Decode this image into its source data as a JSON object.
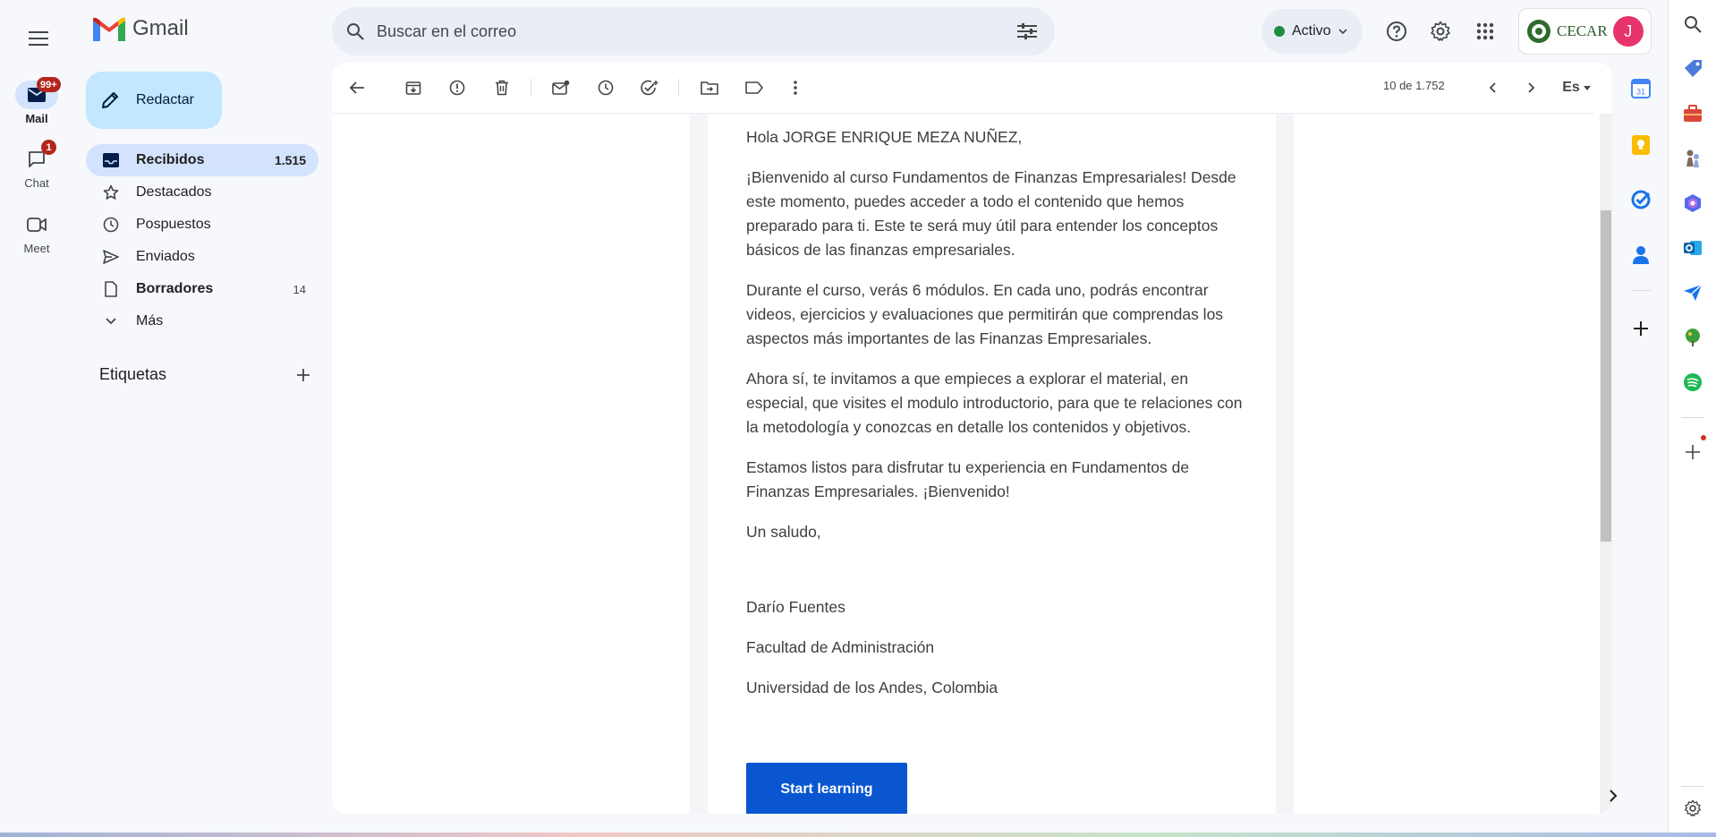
{
  "app": {
    "name": "Gmail"
  },
  "rail": {
    "items": [
      {
        "label": "Mail",
        "badge": "99+",
        "active": true
      },
      {
        "label": "Chat",
        "badge": "1"
      },
      {
        "label": "Meet",
        "badge": ""
      }
    ]
  },
  "search": {
    "placeholder": "Buscar en el correo"
  },
  "header": {
    "status": "Activo",
    "account_org": "CECAR",
    "avatar_letter": "J"
  },
  "compose": {
    "label": "Redactar"
  },
  "nav": {
    "items": [
      {
        "label": "Recibidos",
        "count": "1.515"
      },
      {
        "label": "Destacados",
        "count": ""
      },
      {
        "label": "Pospuestos",
        "count": ""
      },
      {
        "label": "Enviados",
        "count": ""
      },
      {
        "label": "Borradores",
        "count": "14"
      },
      {
        "label": "Más",
        "count": ""
      }
    ],
    "labels_heading": "Etiquetas"
  },
  "toolbar": {
    "pager": "10 de 1.752",
    "lang": "Es"
  },
  "email": {
    "greeting": "Hola JORGE ENRIQUE MEZA NUÑEZ,",
    "p1": "¡Bienvenido al curso Fundamentos de Finanzas Empresariales! Desde este momento, puedes acceder a todo el contenido que hemos preparado para ti. Este te será muy útil para entender los conceptos básicos de las finanzas empresariales.",
    "p2": "Durante el curso, verás 6 módulos. En cada uno, podrás encontrar videos, ejercicios y evaluaciones que permitirán que comprendas los aspectos más importantes de las Finanzas Empresariales.",
    "p3": "Ahora sí, te invitamos a que empieces a explorar el material, en especial, que visites el modulo introductorio, para que te relaciones con la metodología y conozcas en detalle los contenidos y objetivos.",
    "p4": "Estamos listos para disfrutar tu experiencia en Fundamentos de Finanzas Empresariales. ¡Bienvenido!",
    "closing": "Un saludo,",
    "sig_name": "Darío Fuentes",
    "sig_faculty": "Facultad de Administración",
    "sig_university": "Universidad de los Andes, Colombia",
    "cta": "Start learning"
  },
  "colors": {
    "accent": "#0b57d0",
    "cta": "#0a56d0",
    "badge": "#b3261e"
  }
}
